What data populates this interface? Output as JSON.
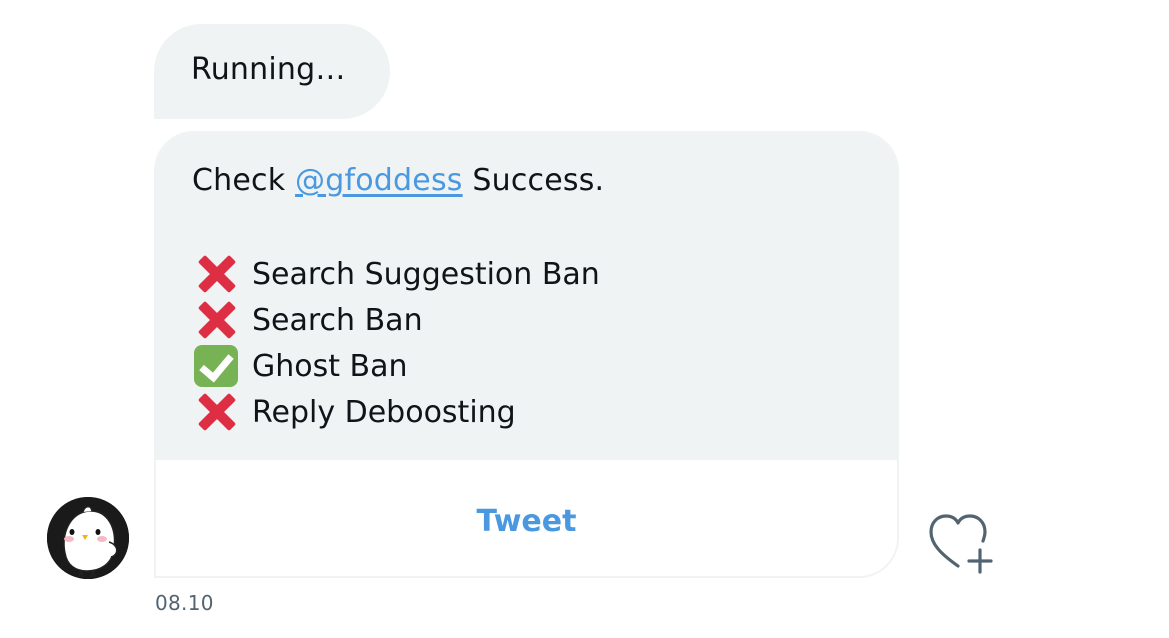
{
  "messages": {
    "status_text": "Running…",
    "card": {
      "check_prefix": "Check",
      "mention": "@gfoddess",
      "check_suffix": "Success.",
      "items": [
        {
          "icon": "cross-mark-icon",
          "label": "Search Suggestion Ban"
        },
        {
          "icon": "cross-mark-icon",
          "label": "Search Ban"
        },
        {
          "icon": "check-mark-icon",
          "label": "Ghost Ban"
        },
        {
          "icon": "cross-mark-icon",
          "label": "Reply Deboosting"
        }
      ],
      "button_label": "Tweet"
    },
    "timestamp": "08.10"
  },
  "colors": {
    "bubble_bg": "#eff3f4",
    "link": "#4a98e0",
    "cross": "#dd2e44",
    "check": "#77b255",
    "muted": "#536471"
  }
}
